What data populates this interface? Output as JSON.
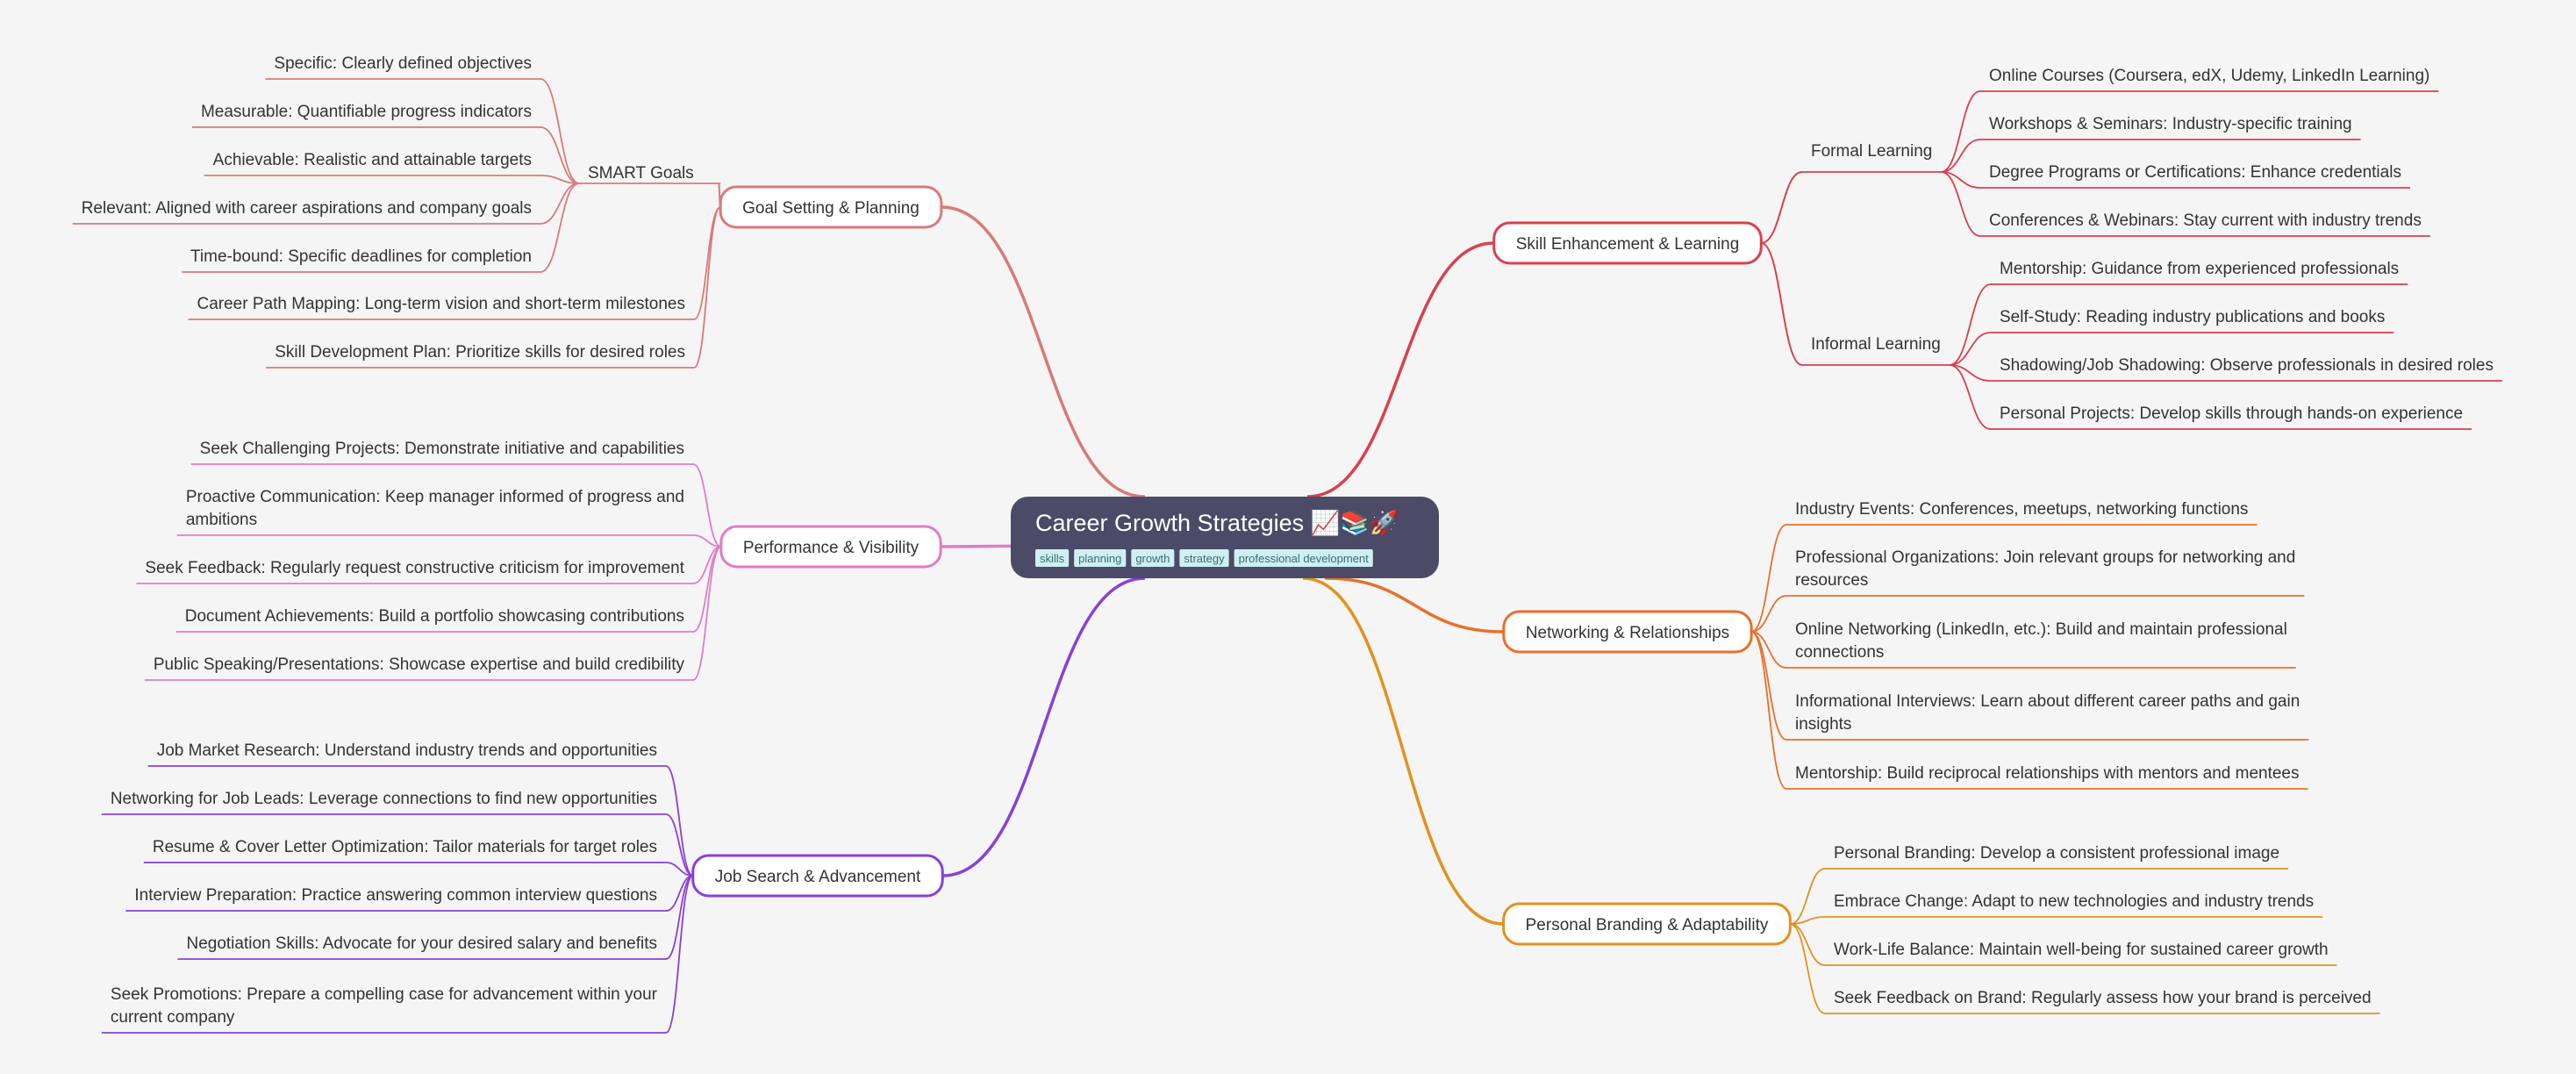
{
  "root": {
    "title": "Career Growth Strategies 📈📚🚀",
    "tags": [
      "skills",
      "planning",
      "growth",
      "strategy",
      "professional development"
    ],
    "fill": "#4b4b68",
    "tag_fill": "#cfeff3"
  },
  "branches": [
    {
      "id": "goal-setting",
      "label": "Goal Setting & Planning",
      "side": "left",
      "color": "#d87a7a",
      "children": [
        {
          "label": "SMART Goals",
          "children": [
            "Specific: Clearly defined objectives",
            "Measurable: Quantifiable progress indicators",
            "Achievable: Realistic and attainable targets",
            "Relevant: Aligned with career aspirations and company goals",
            "Time-bound: Specific deadlines for completion"
          ]
        },
        {
          "label": "Career Path Mapping: Long-term vision and short-term milestones"
        },
        {
          "label": "Skill Development Plan: Prioritize skills for desired roles"
        }
      ]
    },
    {
      "id": "performance",
      "label": "Performance & Visibility",
      "side": "left",
      "color": "#e07cc6",
      "children": [
        {
          "label": "Seek Challenging Projects: Demonstrate initiative and capabilities"
        },
        {
          "label": [
            "Proactive Communication: Keep manager informed of progress and",
            "ambitions"
          ]
        },
        {
          "label": "Seek Feedback: Regularly request constructive criticism for improvement"
        },
        {
          "label": "Document Achievements: Build a portfolio showcasing contributions"
        },
        {
          "label": "Public Speaking/Presentations: Showcase expertise and build credibility"
        }
      ]
    },
    {
      "id": "job-search",
      "label": "Job Search & Advancement",
      "side": "left",
      "color": "#8a3fd8",
      "children": [
        {
          "label": "Job Market Research: Understand industry trends and opportunities"
        },
        {
          "label": "Networking for Job Leads: Leverage connections to find new opportunities"
        },
        {
          "label": "Resume & Cover Letter Optimization: Tailor materials for target roles"
        },
        {
          "label": "Interview Preparation: Practice answering common interview questions"
        },
        {
          "label": "Negotiation Skills: Advocate for your desired salary and benefits"
        },
        {
          "label": [
            "Seek Promotions: Prepare a compelling case for advancement within your",
            "current company"
          ]
        }
      ]
    },
    {
      "id": "skill-enhancement",
      "label": "Skill Enhancement & Learning",
      "side": "right",
      "color": "#d9404f",
      "children": [
        {
          "label": "Formal Learning",
          "children": [
            "Online Courses (Coursera, edX, Udemy, LinkedIn Learning)",
            "Workshops & Seminars: Industry-specific training",
            "Degree Programs or Certifications: Enhance credentials",
            "Conferences & Webinars: Stay current with industry trends"
          ]
        },
        {
          "label": "Informal Learning",
          "children": [
            "Mentorship: Guidance from experienced professionals",
            "Self-Study: Reading industry publications and books",
            "Shadowing/Job Shadowing: Observe professionals in desired roles",
            "Personal Projects: Develop skills through hands-on experience"
          ]
        }
      ]
    },
    {
      "id": "networking",
      "label": "Networking & Relationships",
      "side": "right",
      "color": "#e8702a",
      "children": [
        {
          "label": "Industry Events: Conferences, meetups, networking functions"
        },
        {
          "label": [
            "Professional Organizations: Join relevant groups for networking and",
            "resources"
          ]
        },
        {
          "label": [
            "Online Networking (LinkedIn, etc.): Build and maintain professional",
            "connections"
          ]
        },
        {
          "label": [
            "Informational Interviews: Learn about different career paths and gain",
            "insights"
          ]
        },
        {
          "label": "Mentorship: Build reciprocal relationships with mentors and mentees"
        }
      ]
    },
    {
      "id": "branding",
      "label": "Personal Branding & Adaptability",
      "side": "right",
      "color": "#e0931f",
      "children": [
        {
          "label": "Personal Branding: Develop a consistent professional image"
        },
        {
          "label": "Embrace Change: Adapt to new technologies and industry trends"
        },
        {
          "label": "Work-Life Balance: Maintain well-being for sustained career growth"
        },
        {
          "label": "Seek Feedback on Brand: Regularly assess how your brand is perceived"
        }
      ]
    }
  ]
}
